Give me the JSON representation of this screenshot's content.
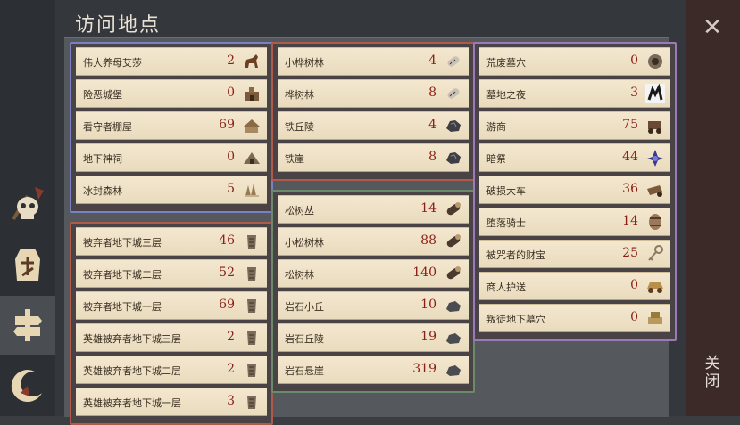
{
  "title": "访问地点",
  "close_label": "关闭",
  "left_tabs": [
    {
      "icon": "skull-icon",
      "active": false
    },
    {
      "icon": "character-token-icon",
      "active": false
    },
    {
      "icon": "signpost-icon",
      "active": true
    },
    {
      "icon": "crescent-icon",
      "active": false
    }
  ],
  "groups": [
    {
      "frame_color": "#7a80c4",
      "items": [
        {
          "name": "伟大养母艾莎",
          "count": "2",
          "icon": "horse-icon"
        },
        {
          "name": "险恶城堡",
          "count": "0",
          "icon": "castle-icon"
        },
        {
          "name": "看守者棚屋",
          "count": "69",
          "icon": "hut-icon"
        },
        {
          "name": "地下神祠",
          "count": "0",
          "icon": "shrine-icon"
        },
        {
          "name": "冰封森林",
          "count": "5",
          "icon": "frozen-forest-icon"
        }
      ]
    },
    {
      "frame_color": "#b05a4a",
      "items": [
        {
          "name": "被弃者地下城三层",
          "count": "46",
          "icon": "dungeon-icon"
        },
        {
          "name": "被弃者地下城二层",
          "count": "52",
          "icon": "dungeon-icon"
        },
        {
          "name": "被弃者地下城一层",
          "count": "69",
          "icon": "dungeon-icon"
        },
        {
          "name": "英雄被弃者地下城三层",
          "count": "2",
          "icon": "dungeon-icon"
        },
        {
          "name": "英雄被弃者地下城二层",
          "count": "2",
          "icon": "dungeon-icon"
        },
        {
          "name": "英雄被弃者地下城一层",
          "count": "3",
          "icon": "dungeon-icon"
        }
      ]
    },
    {
      "frame_color": "#b05a4a",
      "items": [
        {
          "name": "小桦树林",
          "count": "4",
          "icon": "birch-log-icon"
        },
        {
          "name": "桦树林",
          "count": "8",
          "icon": "birch-log-icon"
        },
        {
          "name": "铁丘陵",
          "count": "4",
          "icon": "iron-ore-icon"
        },
        {
          "name": "铁崖",
          "count": "8",
          "icon": "iron-ore-icon"
        }
      ]
    },
    {
      "frame_color": "#6b8a6a",
      "items": [
        {
          "name": "松树丛",
          "count": "14",
          "icon": "pine-log-icon"
        },
        {
          "name": "小松树林",
          "count": "88",
          "icon": "pine-log-icon"
        },
        {
          "name": "松树林",
          "count": "140",
          "icon": "pine-log-icon"
        },
        {
          "name": "岩石小丘",
          "count": "10",
          "icon": "stone-icon"
        },
        {
          "name": "岩石丘陵",
          "count": "19",
          "icon": "stone-icon"
        },
        {
          "name": "岩石悬崖",
          "count": "319",
          "icon": "stone-icon"
        }
      ]
    },
    {
      "frame_color": "#9a7bb8",
      "items": [
        {
          "name": "荒废墓穴",
          "count": "0",
          "icon": "crypt-icon"
        },
        {
          "name": "墓地之夜",
          "count": "3",
          "icon": "graveyard-icon"
        },
        {
          "name": "游商",
          "count": "75",
          "icon": "merchant-cart-icon"
        },
        {
          "name": "暗祭",
          "count": "44",
          "icon": "dark-ritual-icon"
        },
        {
          "name": "破损大车",
          "count": "36",
          "icon": "broken-wagon-icon"
        },
        {
          "name": "堕落骑士",
          "count": "14",
          "icon": "barrel-icon"
        },
        {
          "name": "被咒者的财宝",
          "count": "25",
          "icon": "key-icon"
        },
        {
          "name": "商人护送",
          "count": "0",
          "icon": "caravan-icon"
        },
        {
          "name": "叛徒地下墓穴",
          "count": "0",
          "icon": "tomb-icon"
        }
      ]
    }
  ]
}
